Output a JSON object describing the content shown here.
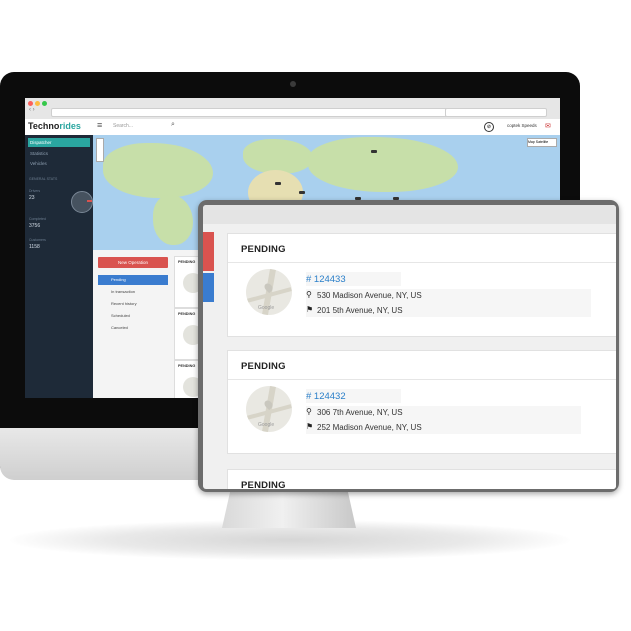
{
  "app": {
    "logo_main": "Techno",
    "logo_accent": "rides",
    "search_placeholder": "Search...",
    "user_name": "coptek Speeds",
    "compass_glyph": "⊘"
  },
  "sidebar": {
    "items": [
      {
        "label": "Dispatcher",
        "active": true
      },
      {
        "label": "Statistics",
        "active": false
      },
      {
        "label": "Vehicles",
        "active": false
      }
    ],
    "section_label": "GENERAL STATS",
    "stats": [
      {
        "label": "Drivers",
        "value": "23"
      },
      {
        "label": "Completed",
        "value": "3756"
      },
      {
        "label": "Customers",
        "value": "1158"
      }
    ]
  },
  "map": {
    "type_control": "Map  Satellite"
  },
  "operations": {
    "new_button": "New Operation",
    "filters": [
      {
        "label": "Pending",
        "active": true
      },
      {
        "label": "In transaction",
        "active": false
      },
      {
        "label": "Recent history",
        "active": false
      },
      {
        "label": "Scheduled",
        "active": false
      },
      {
        "label": "Canceled",
        "active": false
      }
    ]
  },
  "mini_cards": [
    "PENDING",
    "PENDING",
    "PENDING"
  ],
  "cards": [
    {
      "status": "PENDING",
      "order_id": "# 124433",
      "pickup": "530 Madison Avenue, NY, US",
      "dropoff": "201 5th Avenue, NY, US"
    },
    {
      "status": "PENDING",
      "order_id": "# 124432",
      "pickup": "306 7th Avenue, NY, US",
      "dropoff": "252 Madison Avenue, NY, US"
    },
    {
      "status": "PENDING"
    }
  ],
  "icons": {
    "pickup": "location-pin-icon",
    "dropoff": "flag-icon"
  },
  "colors": {
    "accent_teal": "#2aa6a0",
    "danger_red": "#d9534f",
    "primary_blue": "#3a7ccf",
    "link_blue": "#2a7fc9",
    "sidebar_bg": "#1e2a38"
  }
}
